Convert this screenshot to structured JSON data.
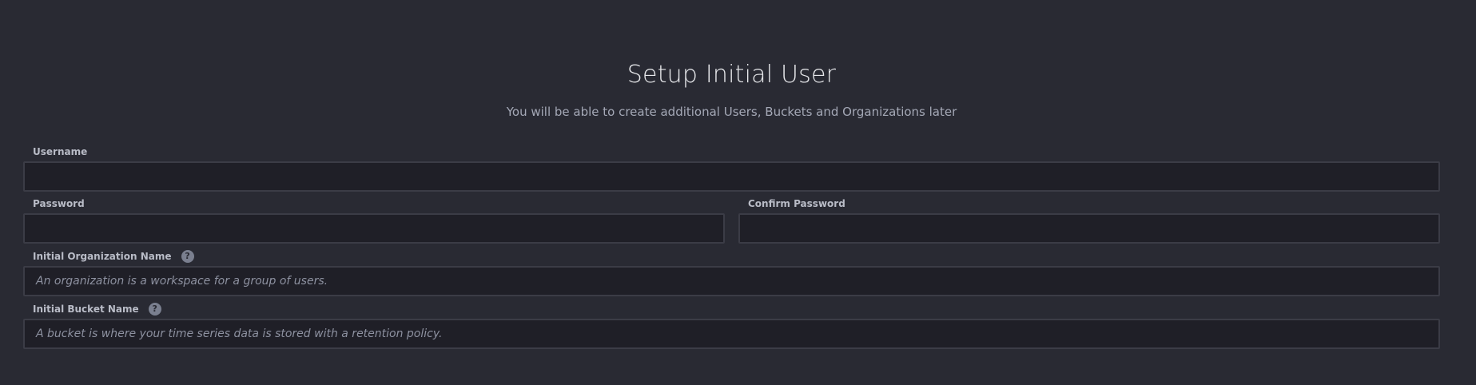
{
  "page": {
    "title": "Setup Initial User",
    "subtitle": "You will be able to create additional Users, Buckets and Organizations later"
  },
  "form": {
    "username": {
      "label": "Username",
      "value": "",
      "placeholder": ""
    },
    "password": {
      "label": "Password",
      "value": "",
      "placeholder": ""
    },
    "confirm_password": {
      "label": "Confirm Password",
      "value": "",
      "placeholder": ""
    },
    "organization": {
      "label": "Initial Organization Name",
      "value": "",
      "placeholder": "An organization is a workspace for a group of users.",
      "help_icon": "question-circle-icon",
      "help_glyph": "?"
    },
    "bucket": {
      "label": "Initial Bucket Name",
      "value": "",
      "placeholder": "A bucket is where your time series data is stored with a retention policy.",
      "help_icon": "question-circle-icon",
      "help_glyph": "?"
    }
  },
  "colors": {
    "background": "#292a33",
    "input_background": "#1f1f27",
    "input_border": "#3b3c46",
    "label_text": "#b9bcc7",
    "placeholder_text": "#8d91a0",
    "title_text": "#e7e8eb",
    "subtitle_text": "#a4a8b6"
  }
}
